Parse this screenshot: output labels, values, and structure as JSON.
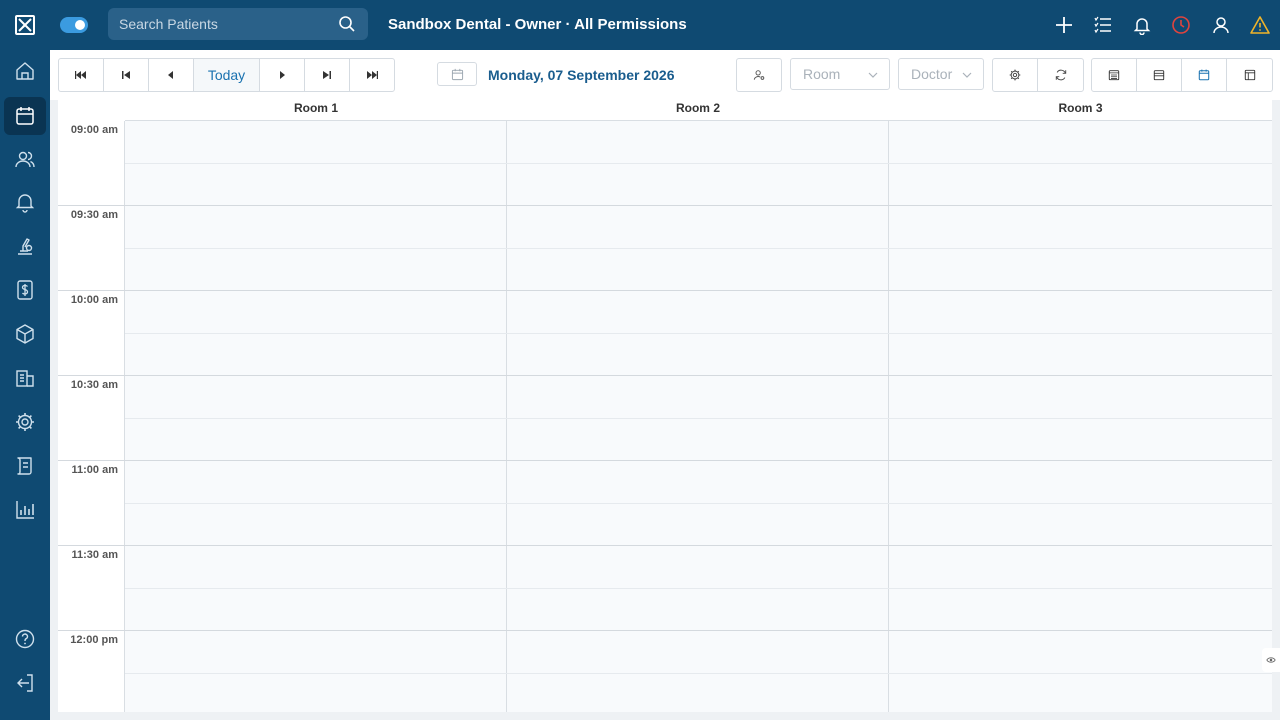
{
  "header": {
    "search_placeholder": "Search Patients",
    "title": "Sandbox Dental - Owner · All Permissions",
    "icons": [
      "plus-icon",
      "list-icon",
      "bell-icon",
      "clock-icon",
      "user-icon",
      "warning-icon"
    ]
  },
  "sidebar": {
    "items": [
      "home-icon",
      "calendar-icon",
      "patients-icon",
      "notifications-icon",
      "treatment-icon",
      "billing-icon",
      "inventory-icon",
      "clinic-icon",
      "settings-icon",
      "reports-icon",
      "analytics-icon"
    ],
    "active": "calendar-icon",
    "bottom": [
      "help-icon",
      "logout-icon"
    ]
  },
  "toolbar": {
    "today_label": "Today",
    "date_label": "Monday, 07 September 2026",
    "room_placeholder": "Room",
    "doctor_placeholder": "Doctor"
  },
  "calendar": {
    "rooms": [
      "Room 1",
      "Room 2",
      "Room 3"
    ],
    "times": [
      "09:00 am",
      "09:30 am",
      "10:00 am",
      "10:30 am",
      "11:00 am",
      "11:30 am",
      "12:00 pm"
    ]
  },
  "colors": {
    "brand": "#0f4a72",
    "accent": "#1a72b0",
    "alert": "#e0443e",
    "warning": "#f0b429"
  }
}
